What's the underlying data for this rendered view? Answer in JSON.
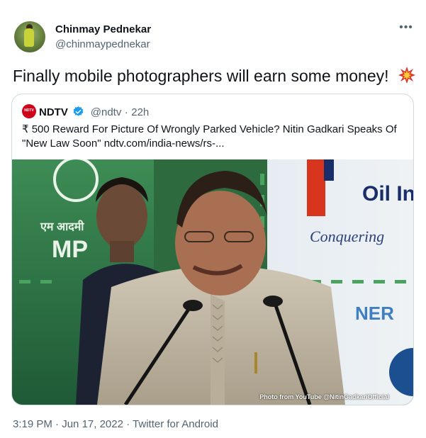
{
  "author": {
    "name": "Chinmay Pednekar",
    "handle": "@chinmaypednekar",
    "avatar_icon": "avatar-photo"
  },
  "more_icon": "more-horizontal-icon",
  "tweet": {
    "text": "Finally mobile photographers will earn some money!",
    "emoji": "collision-icon"
  },
  "quote": {
    "logo": "NDTV",
    "name": "NDTV",
    "handle": "@ndtv",
    "separator": "·",
    "time": "22h",
    "text_line1": "₹ 500 Reward For Picture Of Wrongly Parked Vehicle? Nitin Gadkari Speaks Of",
    "text_line2": "\"New Law Soon\" ndtv.com/india-news/rs-...",
    "media": {
      "credit": "Photo from YouTube @NitinGadkariOfficial",
      "backdrop_text_1": "Oil In",
      "backdrop_text_2": "Conquering",
      "backdrop_text_3": "NER",
      "backdrop_text_4": "एम आदमी",
      "backdrop_text_5": "MP"
    }
  },
  "meta": {
    "time": "3:19 PM",
    "sep1": "·",
    "date": "Jun 17, 2022",
    "sep2": "·",
    "client": "Twitter for Android"
  },
  "colors": {
    "text": "#0f1419",
    "secondary": "#536471",
    "verified": "#1d9bf0",
    "ndtv_red": "#d0021b",
    "border": "#cfd9de"
  }
}
